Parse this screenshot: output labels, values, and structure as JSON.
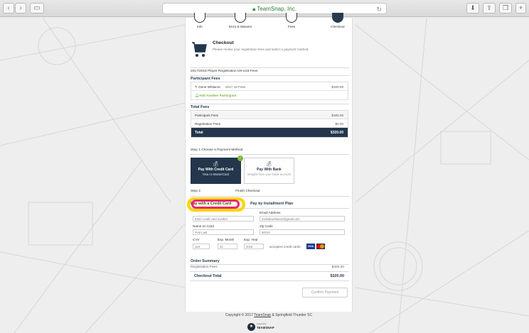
{
  "browser": {
    "url_text": "TeamSnap, Inc."
  },
  "steps": [
    {
      "label": "Info"
    },
    {
      "label": "Docs & Waivers"
    },
    {
      "label": "Fees"
    },
    {
      "label": "Checkout"
    }
  ],
  "checkout": {
    "title": "Checkout",
    "subtitle": "Please review your registration fees and select a payment method."
  },
  "program": "2017/2018 Player Registration U9-U15 Fees",
  "participant_fees": {
    "heading": "Participant Fees",
    "rows": [
      {
        "name": "Gene Whitacre",
        "desc": "2017-18 Fees",
        "amount": "$320.00"
      }
    ],
    "add_link": "Add Another Participant"
  },
  "total_fees": {
    "heading": "Total Fees",
    "rows": [
      {
        "label": "Participant Fees",
        "amount": "$320.00"
      },
      {
        "label": "Registration Fees",
        "amount": "$0.00"
      }
    ],
    "total_label": "Total",
    "total_amount": "$320.00"
  },
  "step1": {
    "label": "Step 1",
    "text": "Choose a Payment Method"
  },
  "payment_methods": [
    {
      "title": "Pay With Credit Card",
      "sub": "Visa or MasterCard",
      "selected": true
    },
    {
      "title": "Pay With Bank",
      "sub": "straight from your bank account",
      "selected": false
    }
  ],
  "step2": {
    "label": "Step 2",
    "text": "Finish Checkout"
  },
  "tabs": {
    "credit_card": "Pay with a Credit Card",
    "installment": "Pay by Installment Plan"
  },
  "form": {
    "card_number_placeholder": "Enter credit card number",
    "email_label": "Email Address",
    "email_value": "melodiewhitacre@gmail.com",
    "name_label": "Name on Card",
    "name_placeholder": "First Last",
    "zip_label": "Zip Code",
    "zip_placeholder": "90210",
    "cvv_label": "CVV",
    "cvv_placeholder": "123",
    "month_label": "Exp. Month",
    "month_placeholder": "01",
    "year_label": "Exp. Year",
    "year_placeholder": "2018",
    "accepted_text": "accepted credit cards",
    "visa_text": "VISA"
  },
  "order_summary": {
    "heading": "Order Summary",
    "rows": [
      {
        "label": "Registration Fees",
        "amount": "$320.00"
      }
    ],
    "total_label": "Checkout Total",
    "total_amount": "$320.00"
  },
  "confirm_button": "Confirm Payment",
  "footer": {
    "copyright_prefix": "Copyright © 2017",
    "teamsnap_link": "TeamSnap",
    "copyright_suffix": "& Springfield Thunder SC",
    "powered_by": "powered by",
    "brand_name": "TEAMSNAP"
  },
  "colors": {
    "navy": "#23364b",
    "green": "#7cb342",
    "highlight_yellow": "#ffd400",
    "highlight_pink": "#e8257a"
  }
}
